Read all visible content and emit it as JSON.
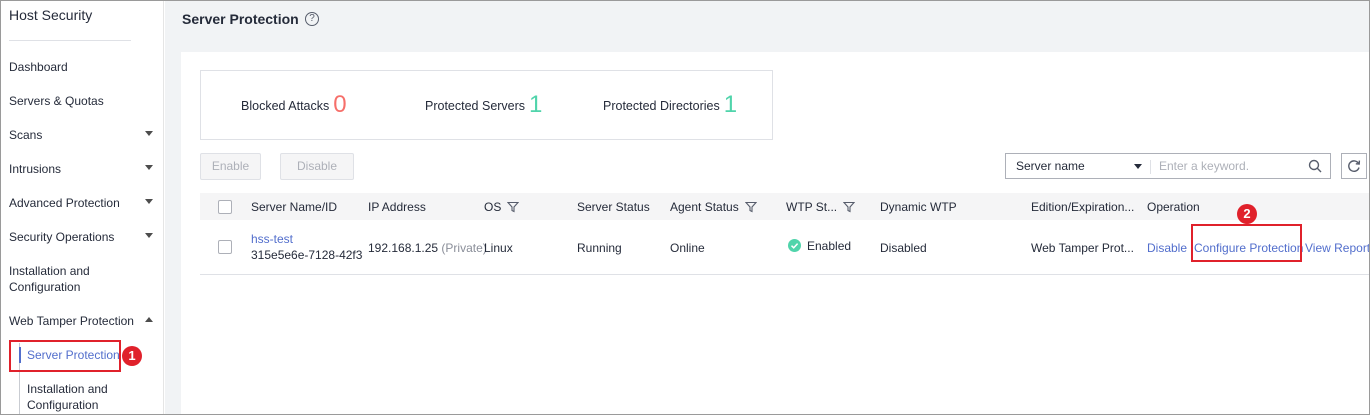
{
  "sidebar": {
    "title": "Host Security",
    "items": [
      {
        "label": "Dashboard"
      },
      {
        "label": "Servers & Quotas"
      },
      {
        "label": "Scans"
      },
      {
        "label": "Intrusions"
      },
      {
        "label": "Advanced Protection"
      },
      {
        "label": "Security Operations"
      },
      {
        "label": "Installation and\nConfiguration"
      },
      {
        "label": "Web Tamper Protection"
      }
    ],
    "sub_items": [
      {
        "label": "Server Protection",
        "active": true
      },
      {
        "label": "Installation and\nConfiguration"
      }
    ]
  },
  "header": {
    "title": "Server Protection",
    "help_glyph": "?"
  },
  "stats": [
    {
      "label": "Blocked Attacks",
      "value": "0"
    },
    {
      "label": "Protected Servers",
      "value": "1"
    },
    {
      "label": "Protected Directories",
      "value": "1"
    }
  ],
  "toolbar": {
    "enable_label": "Enable",
    "disable_label": "Disable",
    "search_field_select": "Server name",
    "search_placeholder": "Enter a keyword."
  },
  "table": {
    "columns": [
      "Server Name/ID",
      "IP Address",
      "OS",
      "Server Status",
      "Agent Status",
      "WTP St...",
      "Dynamic WTP",
      "Edition/Expiration...",
      "Operation"
    ],
    "rows": [
      {
        "server_name": "hss-test",
        "server_id": "315e5e6e-7128-42f3-",
        "ip": "192.168.1.25",
        "ip_type": "(Private)",
        "os": "Linux",
        "server_status": "Running",
        "agent_status": "Online",
        "wtp_status": "Enabled",
        "dynamic_wtp": "Disabled",
        "edition": "Web Tamper Prot...",
        "ops": [
          "Disable",
          "Configure Protection",
          "View Report"
        ]
      }
    ]
  },
  "callouts": [
    "1",
    "2"
  ],
  "colors": {
    "accent": "#526ecc",
    "red_number": "#f66f6a",
    "green_number": "#50d4ab",
    "callout": "#e0212b"
  }
}
